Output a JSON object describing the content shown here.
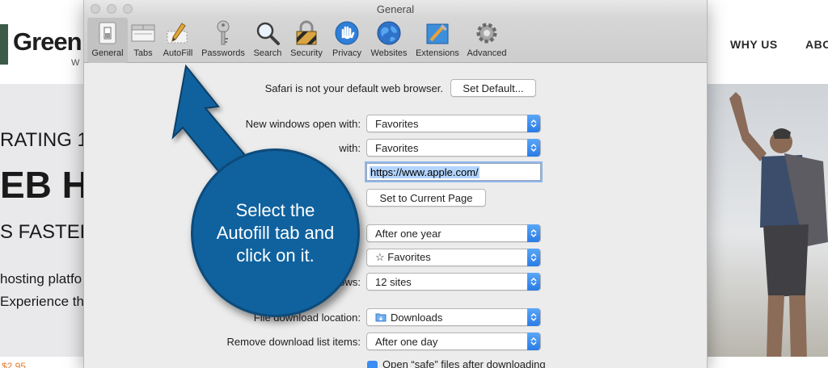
{
  "website": {
    "logo": "Green",
    "logo_sub": "W",
    "nav": [
      "WHY US",
      "ABO"
    ],
    "hero_lines": [
      "RATING 1",
      "EB H",
      "S FASTER",
      "hosting platfo",
      "Experience the"
    ],
    "price": "$2.95"
  },
  "window": {
    "title": "General",
    "toolbar": [
      {
        "label": "General",
        "icon": "general-switch-icon"
      },
      {
        "label": "Tabs",
        "icon": "tabs-icon"
      },
      {
        "label": "AutoFill",
        "icon": "autofill-pencil-icon"
      },
      {
        "label": "Passwords",
        "icon": "key-icon"
      },
      {
        "label": "Search",
        "icon": "magnifier-icon"
      },
      {
        "label": "Security",
        "icon": "lock-icon"
      },
      {
        "label": "Privacy",
        "icon": "hand-icon"
      },
      {
        "label": "Websites",
        "icon": "globe-icon"
      },
      {
        "label": "Extensions",
        "icon": "puzzle-icon"
      },
      {
        "label": "Advanced",
        "icon": "gear-icon"
      }
    ],
    "default_browser": {
      "text": "Safari is not your default web browser.",
      "button": "Set Default..."
    },
    "rows": {
      "new_windows": {
        "label": "New windows open with:",
        "value": "Favorites"
      },
      "new_tabs": {
        "label": "with:",
        "value": "Favorites"
      },
      "homepage": {
        "value": "https://www.apple.com/"
      },
      "set_current": {
        "button": "Set to Current Page"
      },
      "history": {
        "value": "After one year"
      },
      "favorites": {
        "value": "☆ Favorites"
      },
      "top_sites": {
        "label": "ows:",
        "value": "12 sites"
      },
      "download_location": {
        "label": "File download location:",
        "value": "Downloads"
      },
      "remove_downloads": {
        "label": "Remove download list items:",
        "value": "After one day"
      },
      "open_safe": {
        "label": "Open “safe” files after downloading",
        "checked": true
      }
    }
  },
  "callout": {
    "text": "Select the Autofill tab and click on it.",
    "color": "#10629f"
  }
}
